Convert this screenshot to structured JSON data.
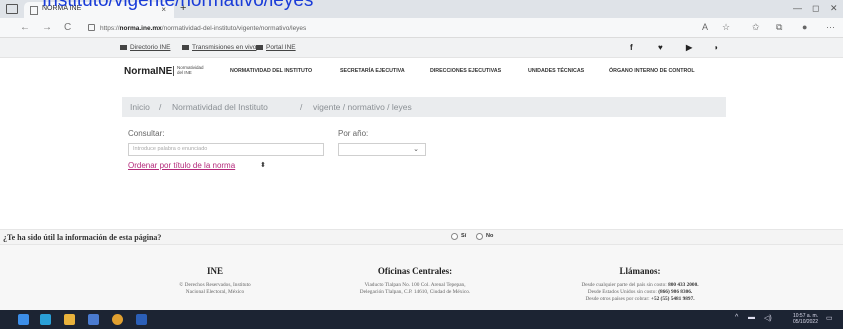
{
  "overlay_caption": "Instituto/vigente/normativo/leyes",
  "browser": {
    "tab_title": "NORMA INE",
    "tab_close": "×",
    "new_tab": "+",
    "url_prefix": "https://",
    "url_domain": "norma.ine.mx",
    "url_path": "/normatividad-del-instituto/vigente/normativo/leyes",
    "back": "←",
    "forward": "→",
    "reload": "C"
  },
  "utility": {
    "links": [
      "Directorio INE",
      "Transmisiones en vivo",
      "Portal INE"
    ]
  },
  "header": {
    "logo": "NormaINE",
    "logo_sub": "Normatividad del INE",
    "menu": [
      "NORMATIVIDAD DEL INSTITUTO",
      "SECRETARÍA EJECUTIVA",
      "DIRECCIONES EJECUTIVAS",
      "UNIDADES TÉCNICAS",
      "ÓRGANO INTERNO DE CONTROL"
    ]
  },
  "breadcrumb": {
    "items": [
      "Inicio",
      "Normatividad del Instituto",
      "vigente / normativo / leyes"
    ],
    "separator": "/"
  },
  "form": {
    "consult_label": "Consultar:",
    "consult_placeholder": "Introduce palabra o enunciado",
    "year_label": "Por año:",
    "year_value": "",
    "sort_link": "Ordenar por título de la norma",
    "sort_arrows": "⬍"
  },
  "feedback": {
    "question": "¿Te ha sido útil la información de esta página?",
    "yes": "Sí",
    "no": "No"
  },
  "footer": {
    "col1_title": "INE",
    "col1_lines": [
      "© Derechos Reservados, Instituto",
      "Nacional Electoral, México"
    ],
    "col2_title": "Oficinas Centrales:",
    "col2_lines": [
      "Viaducto Tlalpan No. 100 Col. Arenal Tepepan,",
      "Delegación Tlalpan, C.P. 14610, Ciudad de México."
    ],
    "col3_title": "Llámanos:",
    "col3_lines": [
      {
        "text": "Desde cualquier parte del país sin costo:",
        "strong": "800 433 2000."
      },
      {
        "text": "Desde Estados Unidos sin costo:",
        "strong": "(866) 986 8306."
      },
      {
        "text": "Desde otros países por cobrar:",
        "strong": "+52 (55) 5481 9897."
      }
    ]
  },
  "taskbar": {
    "time": "10:57 a. m.",
    "date": "05/10/2022"
  },
  "colors": {
    "link_magenta": "#b3297a",
    "taskbar": "#1c2433",
    "caption_blue": "#1a3cd8"
  }
}
